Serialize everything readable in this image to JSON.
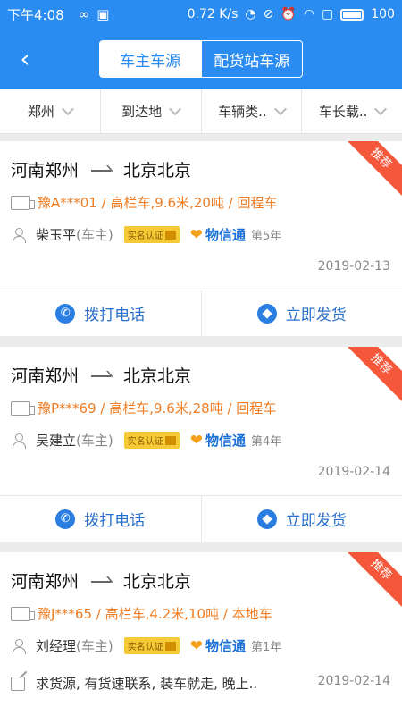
{
  "status": {
    "time": "下午4:08",
    "speed": "0.72 K/s",
    "battery": "100"
  },
  "nav": {
    "seg_active": "车主车源",
    "seg_other": "配货站车源"
  },
  "filters": [
    "郑州",
    "到达地",
    "车辆类..",
    "车长载.."
  ],
  "cards": [
    {
      "ribbon": "推荐",
      "from": "河南郑州",
      "to": "北京北京",
      "vehicle": "豫A***01 / 高栏车,9.6米,20吨 / 回程车",
      "owner": "柴玉平",
      "role": "(车主)",
      "badge": "实名认证",
      "service": "物信通",
      "years": "第5年",
      "date": "2019-02-13",
      "call": "拨打电话",
      "ship": "立即发货"
    },
    {
      "ribbon": "推荐",
      "from": "河南郑州",
      "to": "北京北京",
      "vehicle": "豫P***69 / 高栏车,9.6米,28吨 / 回程车",
      "owner": "吴建立",
      "role": "(车主)",
      "badge": "实名认证",
      "service": "物信通",
      "years": "第4年",
      "date": "2019-02-14",
      "call": "拨打电话",
      "ship": "立即发货"
    },
    {
      "ribbon": "推荐",
      "from": "河南郑州",
      "to": "北京北京",
      "vehicle": "豫J***65 / 高栏车,4.2米,10吨 / 本地车",
      "owner": "刘经理",
      "role": "(车主)",
      "badge": "实名认证",
      "service": "物信通",
      "years": "第1年",
      "remark": "求货源, 有货速联系, 装车就走, 晚上..",
      "date": "2019-02-14"
    }
  ],
  "colors": {
    "primary": "#2a8cf0",
    "ribbon": "#f4573a",
    "vehicle": "#ef7c22"
  }
}
